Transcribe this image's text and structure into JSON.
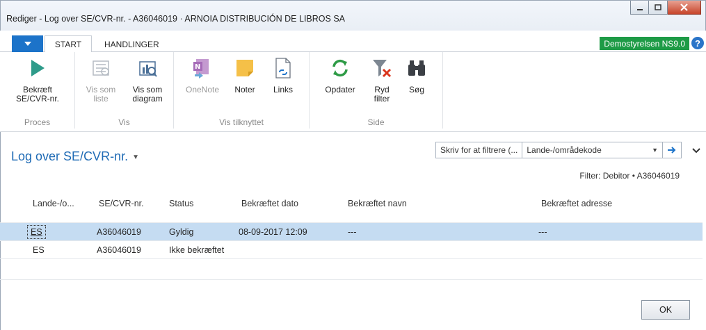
{
  "window": {
    "title": "Rediger - Log over SE/CVR-nr. - A36046019 · ARNOIA DISTRIBUCIÓN DE LIBROS SA",
    "controls": [
      "minimize",
      "maximize",
      "close"
    ]
  },
  "ribbon_tabs": {
    "start": "START",
    "handlinger": "HANDLINGER"
  },
  "company_badge": "Demostyrelsen NS9.0",
  "help_symbol": "?",
  "ribbon": {
    "groups": [
      {
        "label": "Proces",
        "buttons": [
          {
            "label": "Bekræft SE/CVR-nr.",
            "icon": "play-icon",
            "enabled": true
          }
        ]
      },
      {
        "label": "Vis",
        "buttons": [
          {
            "label": "Vis som liste",
            "icon": "list-view-icon",
            "enabled": false
          },
          {
            "label": "Vis som diagram",
            "icon": "chart-view-icon",
            "enabled": true
          }
        ]
      },
      {
        "label": "Vis tilknyttet",
        "buttons": [
          {
            "label": "OneNote",
            "icon": "onenote-icon",
            "enabled": false
          },
          {
            "label": "Noter",
            "icon": "note-icon",
            "enabled": true
          },
          {
            "label": "Links",
            "icon": "link-icon",
            "enabled": true
          }
        ]
      },
      {
        "label": "Side",
        "buttons": [
          {
            "label": "Opdater",
            "icon": "refresh-icon",
            "enabled": true
          },
          {
            "label": "Ryd filter",
            "icon": "clear-filter-icon",
            "enabled": true
          },
          {
            "label": "Søg",
            "icon": "binoculars-icon",
            "enabled": true
          }
        ]
      }
    ]
  },
  "page": {
    "title": "Log over SE/CVR-nr.",
    "filter_placeholder": "Skriv for at filtrere (...",
    "filter_field": "Lande-/områdekode",
    "filter_info": "Filter: Debitor • A36046019"
  },
  "grid": {
    "columns": [
      "Lande-/o...",
      "SE/CVR-nr.",
      "Status",
      "Bekræftet dato",
      "Bekræftet navn",
      "Bekræftet adresse"
    ],
    "rows": [
      {
        "country": "ES",
        "vat": "A36046019",
        "status": "Gyldig",
        "date": "08-09-2017 12:09",
        "name": "---",
        "address": "---",
        "selected": true
      },
      {
        "country": "ES",
        "vat": "A36046019",
        "status": "Ikke bekræftet",
        "date": "",
        "name": "",
        "address": "",
        "selected": false
      }
    ]
  },
  "footer": {
    "ok_label": "OK"
  },
  "colors": {
    "accent": "#1f6bb5",
    "company_badge": "#1e9b46",
    "selection": "#c5dcf2",
    "app_menu": "#1c73c9"
  }
}
